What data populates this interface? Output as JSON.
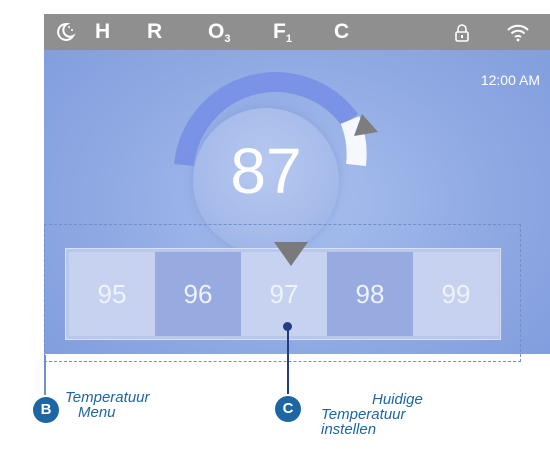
{
  "status_bar": {
    "icons": [
      "moon-icon",
      "lock-icon",
      "wifi-icon"
    ],
    "h": "H",
    "r": "R",
    "o": "O",
    "o_sub": "3",
    "f": "F",
    "f_sub": "1",
    "c": "C"
  },
  "clock": "12:00 AM",
  "current_temperature": "87",
  "temperature_menu": [
    "95",
    "96",
    "97",
    "98",
    "99"
  ],
  "selected_temperature": "97",
  "callouts": {
    "b_badge": "B",
    "b_line1": "Temperatuur",
    "b_line2": "Menu",
    "c_badge": "C",
    "c_line1": "Huidige",
    "c_line2": "Temperatuur",
    "c_line3": "instellen"
  },
  "colors": {
    "screen_bg": "#8fa9e3",
    "status_bar": "#8f8f90",
    "gauge_active": "#7b93e6",
    "gauge_inactive": "#ffffff",
    "callout": "#1e66a3"
  }
}
